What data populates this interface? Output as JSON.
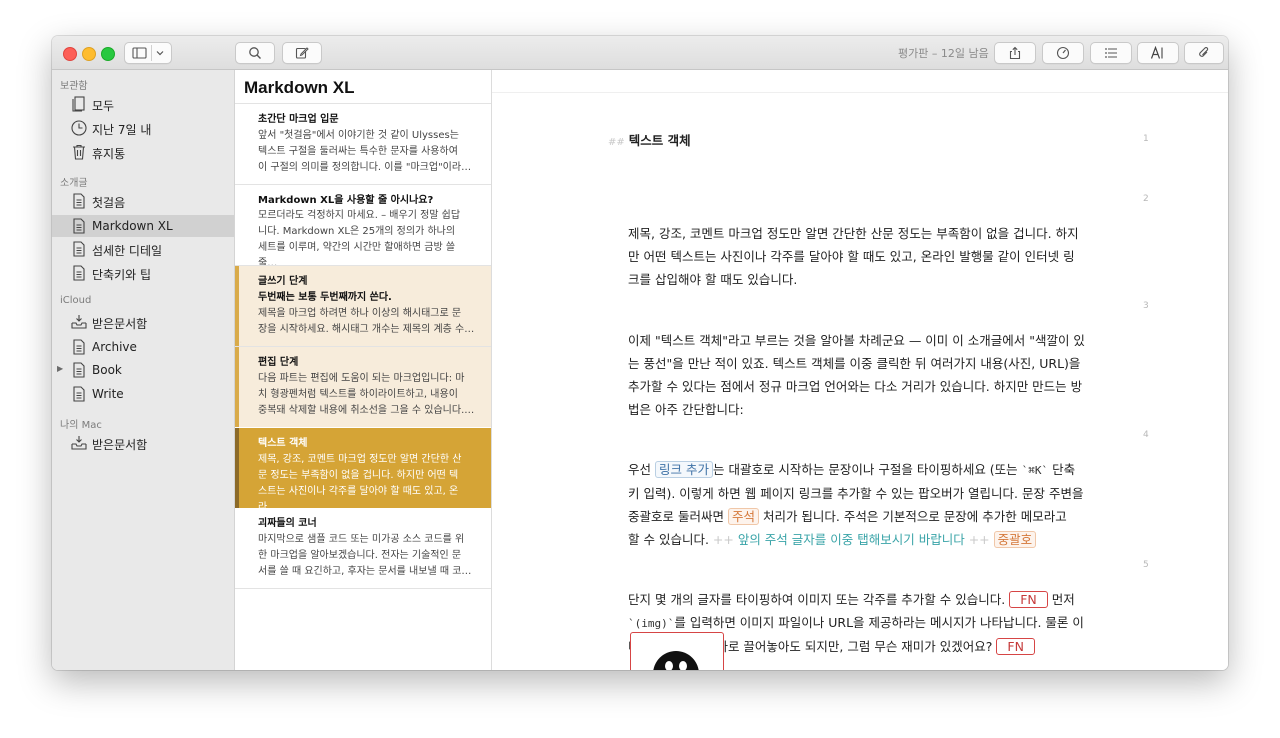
{
  "toolbar": {
    "trial_text": "평가판 – 12일 남음"
  },
  "sidebar": {
    "sections": [
      {
        "title": "보관함",
        "items": [
          {
            "label": "모두",
            "icon": "stack-icon"
          },
          {
            "label": "지난 7일 내",
            "icon": "clock-icon"
          },
          {
            "label": "휴지통",
            "icon": "trash-icon"
          }
        ]
      },
      {
        "title": "소개글",
        "items": [
          {
            "label": "첫걸음",
            "icon": "document-icon"
          },
          {
            "label": "Markdown XL",
            "icon": "document-icon",
            "selected": true
          },
          {
            "label": "섬세한 디테일",
            "icon": "document-icon"
          },
          {
            "label": "단축키와 팁",
            "icon": "document-icon"
          }
        ]
      },
      {
        "title": "iCloud",
        "items": [
          {
            "label": "받은문서함",
            "icon": "inbox-icon"
          },
          {
            "label": "Archive",
            "icon": "document-icon"
          },
          {
            "label": "Book",
            "icon": "document-icon",
            "expandable": true
          },
          {
            "label": "Write",
            "icon": "document-icon"
          }
        ]
      },
      {
        "title": "나의 Mac",
        "items": [
          {
            "label": "받은문서함",
            "icon": "inbox-icon"
          }
        ]
      }
    ]
  },
  "sheet_list": {
    "title": "Markdown XL",
    "sheets": [
      {
        "title": "초간단 마크업 입문",
        "lines": [
          "앞서 \"첫걸음\"에서 이야기한 것 같이 Ulysses는",
          "텍스트 구절을 둘러싸는 특수한 문자를 사용하여",
          "이 구절의 의미를 정의합니다. 이를 \"마크업\"이라…"
        ],
        "state": "normal"
      },
      {
        "title": "Markdown XL을 사용할 줄 아시나요?",
        "lines": [
          "모르더라도 걱정하지 마세요. – 배우기 정말 쉽답",
          "니다. Markdown XL은 25개의 정의가 하나의",
          "세트를 이루며, 약간의 시간만 할애하면 금방 쓸 줄…"
        ],
        "state": "normal"
      },
      {
        "title": "글쓰기 단계",
        "title2": "두번째는 보통 두번째까지 쓴다.",
        "lines": [
          "제목을 마크업 하려면 하나 이상의 해시태그로 문",
          "장을 시작하세요. 해시태그 개수는 제목의 계층 수…"
        ],
        "state": "tinted"
      },
      {
        "title": "편집 단계",
        "lines": [
          "다음 파트는 편집에 도움이 되는 마크업입니다: 마",
          "치 형광펜처럼 텍스트를 하이라이트하고, 내용이",
          "중복돼 삭제할 내용에 취소선을 그을 수 있습니다.…"
        ],
        "state": "tinted"
      },
      {
        "title": "텍스트 객체",
        "lines": [
          "제목, 강조, 코멘트 마크업 정도만 알면 간단한 산",
          "문 정도는 부족함이 없을 겁니다. 하지만 어떤 텍",
          "스트는 사진이나 각주를 달아야 할 때도 있고, 온라…"
        ],
        "state": "active"
      },
      {
        "title": "괴짜들의 코너",
        "lines": [
          "마지막으로 샘플 코드 또는 미가공 소스 코드를 위",
          "한 마크업을 알아보겠습니다. 전자는 기술적인 문",
          "서를 쓸 때 요긴하고, 후자는 문서를 내보낼 때 코…"
        ],
        "state": "normal"
      }
    ]
  },
  "editor": {
    "heading_marker": "##",
    "heading": "텍스트 객체",
    "line_numbers": [
      "1",
      "2",
      "3",
      "4",
      "5"
    ],
    "p2": [
      "제목, 강조, 코멘트 마크업 정도만 알면 간단한 산문 정도는 부족함이 없을 겁니다. 하지",
      "만 어떤 텍스트는 사진이나 각주를 달아야 할 때도 있고, 온라인 발행물 같이 인터넷 링",
      "크를 삽입해야 할 때도 있습니다."
    ],
    "p3": [
      "이제 \"텍스트 객체\"라고 부르는 것을 알아볼 차례군요 — 이미 이 소개글에서 \"색깔이 있",
      "는 풍선\"을 만난 적이 있죠. 텍스트 객체를 이중 클릭한 뒤 여러가지 내용(사진, URL)을",
      "추가할 수 있다는 점에서 정규 마크업 언어와는 다소 거리가 있습니다. 하지만 만드는 방",
      "법은 아주 간단합니다:"
    ],
    "p4": {
      "a": "우선 ",
      "link_chip": "링크 추가",
      "b": "는 대괄호로 시작하는 문장이나 구절을 타이핑하세요 (또는 ",
      "code": "`⌘K`",
      "c": " 단축",
      "line2": "키 입력). 이렇게 하면 웹 페이지 링크를 추가할 수 있는 팝오버가 열립니다. 문장 주변을",
      "d": "중괄호로 둘러싸면 ",
      "note_chip": "주석",
      "e": " 처리가 됩니다. 주석은 기본적으로 문장에 추가한 메모라고",
      "f": "할 수 있습니다. ",
      "plus1": "++",
      "comment": " 앞의 주석 글자를 이중 탭해보시기 바랍니다 ",
      "plus2": "++",
      "brace_chip": "중괄호"
    },
    "p5": {
      "a": "단지 몇 개의 글자를 타이핑하여 이미지 또는 각주를 추가할 수 있습니다. ",
      "fn1": "FN",
      "b": " 먼저",
      "code": "`(img)`",
      "c": "를 입력하면 이미지 파일이나 URL을 제공하라는 메시지가 나타납니다. 물론 이",
      "d": "미지를 텍스트로 바로 끌어놓아도 되지만, 그럼 무슨 재미가 있겠어요? ",
      "fn2": "FN"
    }
  }
}
